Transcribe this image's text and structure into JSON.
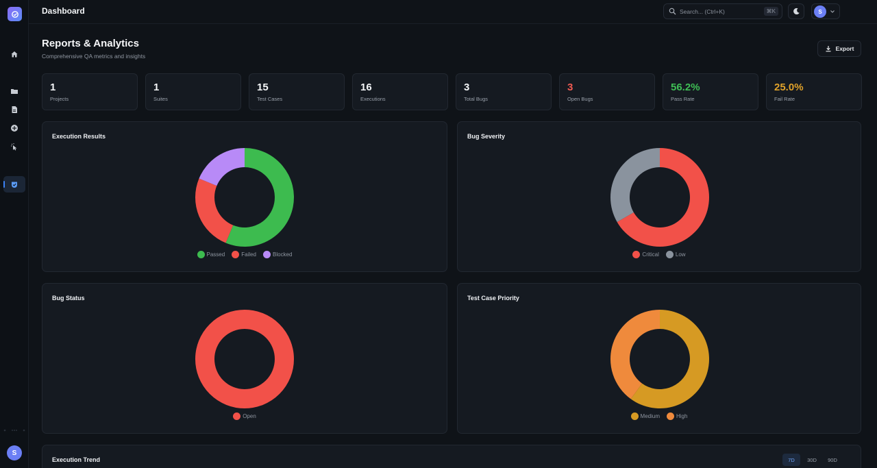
{
  "topbar": {
    "title": "Dashboard",
    "search_placeholder": "Search... (Ctrl+K)",
    "search_shortcut": "⌘K"
  },
  "user": {
    "initial": "S"
  },
  "page": {
    "title": "Reports & Analytics",
    "subtitle": "Comprehensive QA metrics and insights",
    "export_label": "Export"
  },
  "stats": [
    {
      "value": "1",
      "label": "Projects",
      "color": "#f3f5f7"
    },
    {
      "value": "1",
      "label": "Suites",
      "color": "#f3f5f7"
    },
    {
      "value": "15",
      "label": "Test Cases",
      "color": "#f3f5f7"
    },
    {
      "value": "16",
      "label": "Executions",
      "color": "#f3f5f7"
    },
    {
      "value": "3",
      "label": "Total Bugs",
      "color": "#f3f5f7"
    },
    {
      "value": "3",
      "label": "Open Bugs",
      "color": "#f25a52"
    },
    {
      "value": "56.2%",
      "label": "Pass Rate",
      "color": "#3fbf55"
    },
    {
      "value": "25.0%",
      "label": "Fail Rate",
      "color": "#e0a22a"
    }
  ],
  "chart_data": [
    {
      "type": "pie",
      "title": "Execution Results",
      "categories": [
        "Passed",
        "Failed",
        "Blocked"
      ],
      "values": [
        9,
        4,
        3
      ],
      "colors": [
        "#3dbb4f",
        "#f25149",
        "#b88af7"
      ]
    },
    {
      "type": "pie",
      "title": "Bug Severity",
      "categories": [
        "Critical",
        "Low"
      ],
      "values": [
        2,
        1
      ],
      "colors": [
        "#f25149",
        "#8a939e"
      ]
    },
    {
      "type": "pie",
      "title": "Bug Status",
      "categories": [
        "Open"
      ],
      "values": [
        3
      ],
      "colors": [
        "#f25149"
      ]
    },
    {
      "type": "pie",
      "title": "Test Case Priority",
      "categories": [
        "Medium",
        "High"
      ],
      "values": [
        9,
        6
      ],
      "colors": [
        "#d69a23",
        "#ef8a3c"
      ]
    }
  ],
  "trend": {
    "title": "Execution Trend",
    "ranges": [
      "7D",
      "30D",
      "90D"
    ],
    "active_range": "7D"
  },
  "colors": {
    "accent": "#3b82f6",
    "avatar": "#6b7ff5"
  },
  "sidebar": {
    "icons": [
      "home-icon",
      "folder-icon",
      "document-icon",
      "plus-circle-icon",
      "pointer-icon",
      "reports-icon"
    ]
  }
}
